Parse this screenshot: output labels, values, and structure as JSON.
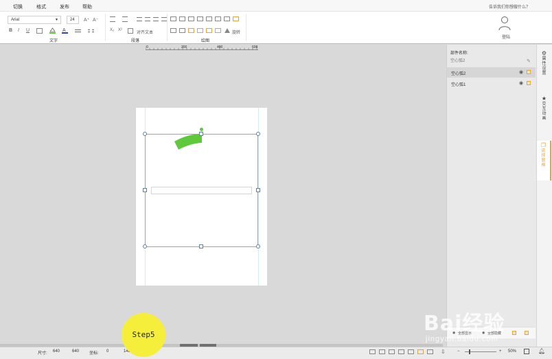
{
  "menubar": {
    "items": [
      "切换",
      "格式",
      "发布",
      "帮助"
    ],
    "help_hint": "告诉我们你想做什么？"
  },
  "ribbon": {
    "font_family": "Arial",
    "font_size": "24",
    "font_grow_glyph": "A⁺",
    "font_shrink_glyph": "A⁻",
    "bold": "B",
    "italic": "I",
    "underline": "U",
    "subscript": "X₂",
    "superscript": "X²",
    "align_text_label": "对齐文本",
    "rotate_label": "旋转",
    "groups": {
      "text": "文字",
      "paragraph": "段落",
      "drawing": "绘图"
    },
    "login_label": "登陆"
  },
  "ruler": {
    "ticks": [
      "0",
      "200",
      "400",
      "600"
    ]
  },
  "panel": {
    "component_name_label": "部件名称:",
    "component_name_value": "空心弧2",
    "layers": [
      {
        "name": "空心弧2",
        "selected": true
      },
      {
        "name": "空心弧1",
        "selected": false
      }
    ],
    "show_all": "全部显示",
    "hide_all": "全部隐藏"
  },
  "side_tabs": [
    {
      "label": "属性设置",
      "icon": "gear-icon",
      "active": false
    },
    {
      "label": "交互动画",
      "icon": "star-icon",
      "active": false
    },
    {
      "label": "选择窗格",
      "icon": "layers-icon",
      "active": true
    }
  ],
  "statusbar": {
    "size_label": "尺寸:",
    "width": "640",
    "height": "640",
    "coord_label": "坐标:",
    "x": "0",
    "y": "148",
    "zoom": "50%",
    "zoom_minus": "−",
    "zoom_plus": "+"
  },
  "step_badge": "Step5",
  "watermark": {
    "main": "Bai经验",
    "sub": "jingyan.baidu.com"
  },
  "colors": {
    "accent": "#e7a23a",
    "arc_fill": "#5fc93c",
    "selection": "#5b7fa8",
    "step_badge": "#f5ef3c"
  }
}
